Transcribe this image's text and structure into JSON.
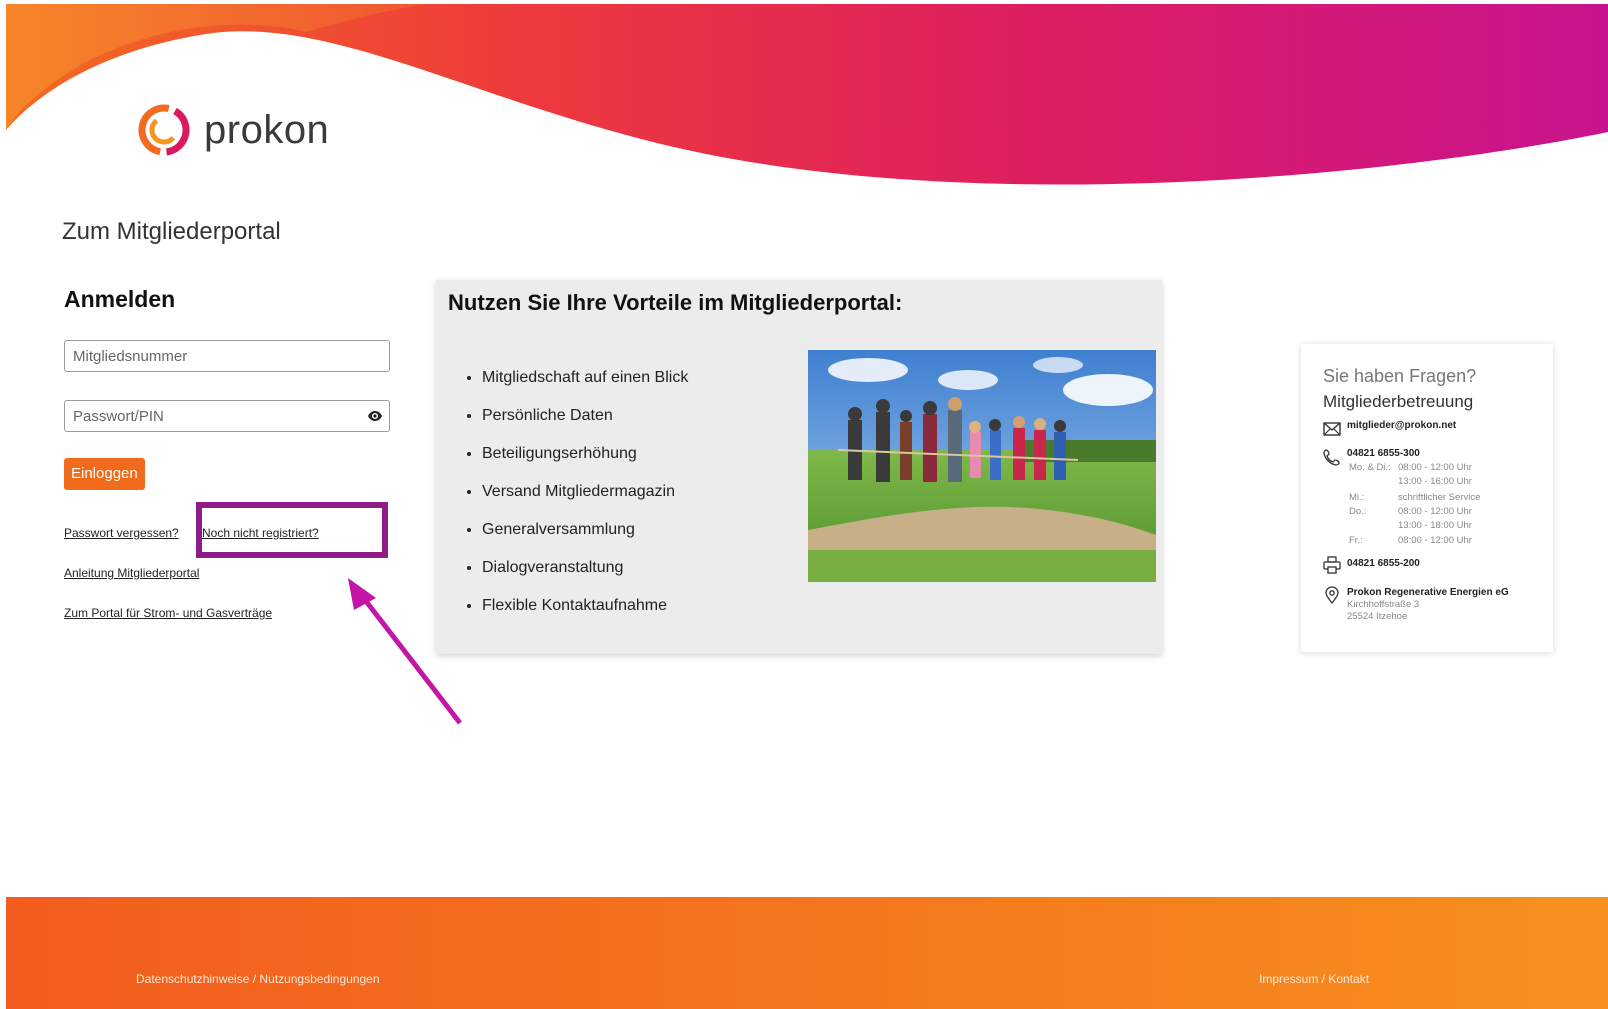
{
  "brand": {
    "name": "prokon"
  },
  "page": {
    "title": "Zum Mitgliederportal"
  },
  "login": {
    "heading": "Anmelden",
    "member_placeholder": "Mitgliedsnummer",
    "password_placeholder": "Passwort/PIN",
    "submit_label": "Einloggen",
    "forgot_password": "Passwort vergessen?",
    "not_registered": "Noch nicht registriert?",
    "guide": "Anleitung Mitgliederportal",
    "energy_portal": "Zum Portal für Strom- und Gasverträge"
  },
  "benefits": {
    "heading": "Nutzen Sie Ihre Vorteile im Mitgliederportal:",
    "items": [
      "Mitgliedschaft auf einen Blick",
      "Persönliche Daten",
      "Beteiligungserhöhung",
      "Versand Mitgliedermagazin",
      "Generalversammlung",
      "Dialogveranstaltung",
      "Flexible Kontaktaufnahme"
    ]
  },
  "contact": {
    "title": "Sie haben Fragen?",
    "subtitle": "Mitgliederbetreuung",
    "email": "mitglieder@prokon.net",
    "phone": "04821 6855-300",
    "hours": [
      {
        "day": "Mo. & Di.:",
        "time": "08:00 - 12:00 Uhr"
      },
      {
        "day": "",
        "time": "13:00 - 16:00 Uhr"
      },
      {
        "day": "Mi.:",
        "time": "schriftlicher Service"
      },
      {
        "day": "Do.:",
        "time": "08:00 - 12:00 Uhr"
      },
      {
        "day": "",
        "time": "13:00 - 18:00 Uhr"
      },
      {
        "day": "Fr.:",
        "time": "08:00 - 12:00 Uhr"
      }
    ],
    "fax": "04821 6855-200",
    "company": "Prokon Regenerative Energien eG",
    "street": "Kirchhoffstraße 3",
    "city": "25524 Itzehoe"
  },
  "footer": {
    "privacy": "Datenschutzhinweise / Nutzungsbedingungen",
    "imprint": "Impressum / Kontakt"
  },
  "colors": {
    "accent": "#f26a1b",
    "header_gradient": [
      "#f36b1f",
      "#e8224f",
      "#c8138e"
    ],
    "annotation": "#8f1c86"
  }
}
